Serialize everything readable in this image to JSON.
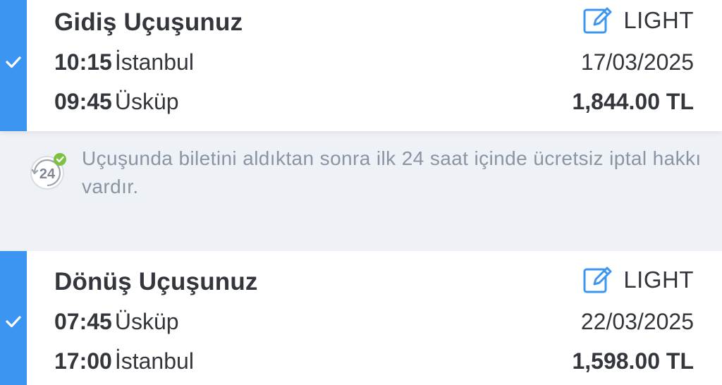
{
  "outbound": {
    "title": "Gidiş Uçuşunuz",
    "fare_label": "LIGHT",
    "depart_time": "10:15",
    "depart_city": "İstanbul",
    "arrive_time": "09:45",
    "arrive_city": "Üsküp",
    "date": "17/03/2025",
    "price": "1,844.00 TL"
  },
  "notice": {
    "badge": "24",
    "text": "Uçuşunda biletini aldıktan sonra ilk 24 saat içinde ücretsiz iptal hakkı vardır."
  },
  "return": {
    "title": "Dönüş Uçuşunuz",
    "fare_label": "LIGHT",
    "depart_time": "07:45",
    "depart_city": "Üsküp",
    "arrive_time": "17:00",
    "arrive_city": "İstanbul",
    "date": "22/03/2025",
    "price": "1,598.00 TL"
  },
  "colors": {
    "accent": "#3d95f2",
    "text": "#33363c",
    "muted": "#8a95a4",
    "background": "#eef1f5",
    "success": "#7cc142"
  },
  "icons": [
    "check-icon",
    "edit-fare-icon",
    "free-cancel-24h-icon"
  ]
}
